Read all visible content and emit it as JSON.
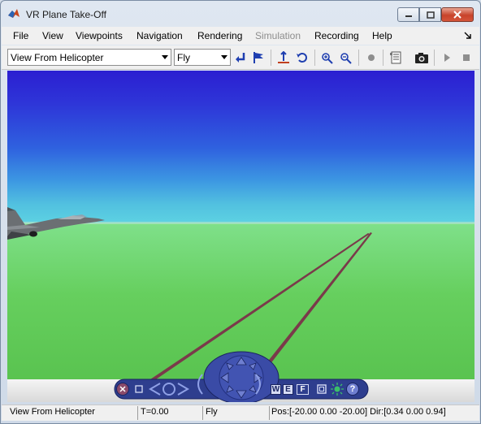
{
  "window": {
    "title": "VR Plane Take-Off"
  },
  "menu": {
    "items": [
      {
        "label": "File",
        "enabled": true
      },
      {
        "label": "View",
        "enabled": true
      },
      {
        "label": "Viewpoints",
        "enabled": true
      },
      {
        "label": "Navigation",
        "enabled": true
      },
      {
        "label": "Rendering",
        "enabled": true
      },
      {
        "label": "Simulation",
        "enabled": false
      },
      {
        "label": "Recording",
        "enabled": true
      },
      {
        "label": "Help",
        "enabled": true
      }
    ]
  },
  "toolbar": {
    "viewpoint_select": "View From Helicopter",
    "navigation_mode_select": "Fly",
    "buttons": [
      "return-to-viewpoint-icon",
      "create-viewpoint-icon",
      "straighten-up-icon",
      "undo-move-icon",
      "zoom-in-icon",
      "zoom-out-icon",
      "record-icon",
      "properties-icon",
      "snapshot-camera-icon",
      "start-simulation-icon",
      "stop-simulation-icon"
    ]
  },
  "viewport": {
    "sky_color": "#2b1fd1",
    "horizon_color": "#5dd2e2",
    "ground_color": "#6ad463",
    "runway_color": "#7a3a4a"
  },
  "nav_panel": {
    "buttons": [
      "W",
      "E",
      "F"
    ],
    "accent": "#2e3e8e"
  },
  "statusbar": {
    "viewpoint": "View From Helicopter",
    "time": "T=0.00",
    "mode": "Fly",
    "position": "Pos:[-20.00 0.00 -20.00] Dir:[0.34 0.00 0.94]"
  }
}
